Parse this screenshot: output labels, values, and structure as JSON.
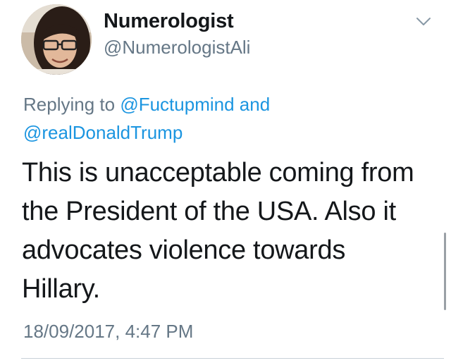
{
  "tweet": {
    "display_name": "Numerologist",
    "handle": "@NumerologistAli",
    "replying_prefix": "Replying to",
    "reply_mention_1": "@Fuctupmind",
    "reply_conjunction": "and",
    "reply_mention_2": "@realDonaldTrump",
    "body_lines": [
      "This is unacceptable coming from",
      "the President of the USA. Also it",
      "advocates violence towards",
      "Hillary."
    ],
    "timestamp": "18/09/2017, 4:47 PM",
    "menu_icon": "chevron-down-icon"
  },
  "colors": {
    "text_primary": "#14171a",
    "text_secondary": "#657786",
    "link": "#1b95e0",
    "divider": "#c8d1d8"
  }
}
